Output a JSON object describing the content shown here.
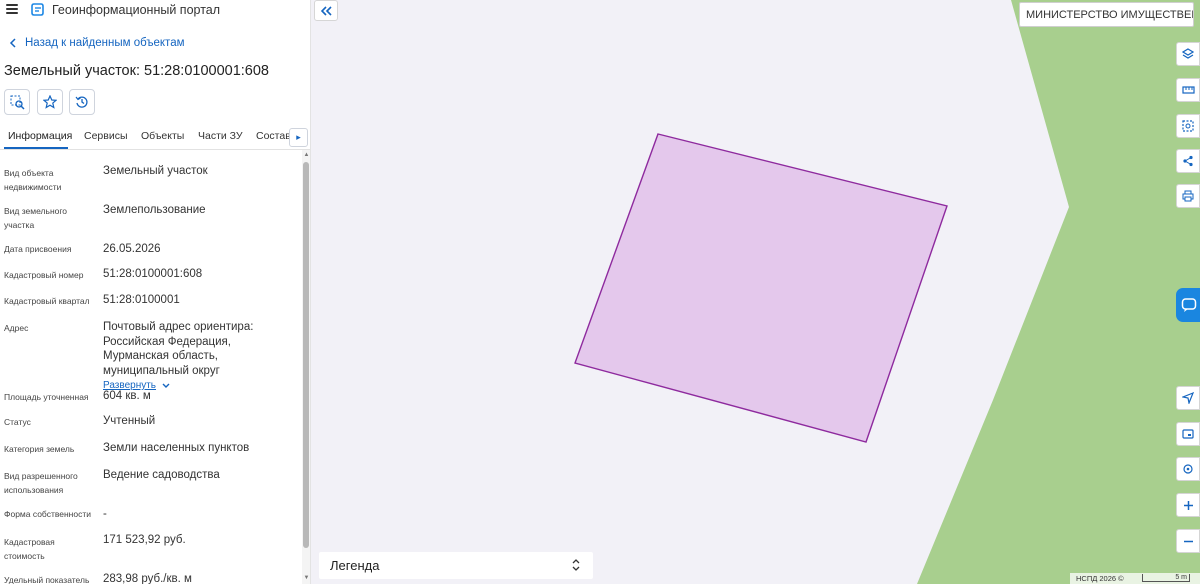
{
  "header": {
    "app_title": "Геоинформационный портал"
  },
  "nav": {
    "back_label": "Назад к найденным объектам"
  },
  "object": {
    "title": "Земельный участок: 51:28:0100001:608"
  },
  "tabs": [
    {
      "label": "Информация"
    },
    {
      "label": "Сервисы"
    },
    {
      "label": "Объекты"
    },
    {
      "label": "Части ЗУ"
    },
    {
      "label": "Состав"
    }
  ],
  "info": [
    {
      "label": "Вид объекта недвижимости",
      "value": "Земельный участок"
    },
    {
      "label": "Вид земельного участка",
      "value": "Землепользование"
    },
    {
      "label": "Дата присвоения",
      "value": "26.05.2026"
    },
    {
      "label": "Кадастровый номер",
      "value": "51:28:0100001:608"
    },
    {
      "label": "Кадастровый квартал",
      "value": "51:28:0100001"
    },
    {
      "label": "Адрес",
      "value": "Почтовый адрес ориентира: Российская Федерация, Мурманская область, муниципальный округ",
      "link": "Развернуть"
    },
    {
      "label": "Площадь уточненная",
      "value": "604 кв. м"
    },
    {
      "label": "Статус",
      "value": "Учтенный"
    },
    {
      "label": "Категория земель",
      "value": "Земли населенных пунктов"
    },
    {
      "label": "Вид разрешенного использования",
      "value": "Ведение садоводства"
    },
    {
      "label": "Форма собственности",
      "value": "-"
    },
    {
      "label": "Кадастровая стоимость",
      "value": "171 523,92 руб."
    },
    {
      "label": "Удельный показатель",
      "value": "283,98 руб./кв. м"
    }
  ],
  "map": {
    "org_select": "МИНИСТЕРСТВО ИМУЩЕСТВЕННЫХ",
    "legend_label": "Легенда",
    "credit": "НСПД 2026 ©",
    "scale_label": "5 m",
    "colors": {
      "green": "#a8cf8e",
      "parcel_fill": "#e4c8ec",
      "parcel_stroke": "#8e2a9e",
      "background": "#f2f1f7"
    }
  }
}
